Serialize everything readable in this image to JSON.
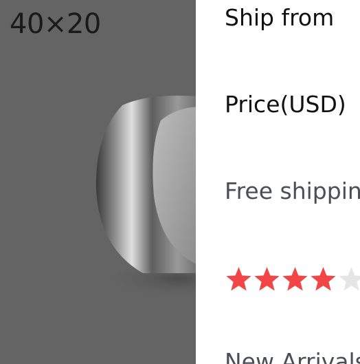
{
  "product_image": {
    "size_label": "40×20",
    "overlay": "dimmed",
    "subject": "magnet-icon"
  },
  "details": {
    "ship_from_label": "Ship from",
    "price_label": "Price(USD)",
    "shipping_label": "Free shippin",
    "rating": {
      "value": 4,
      "max": 5,
      "filled_color": "#f34545",
      "empty_color": "#e5e5e5"
    },
    "new_arrivals_label": "New Arrivals"
  }
}
